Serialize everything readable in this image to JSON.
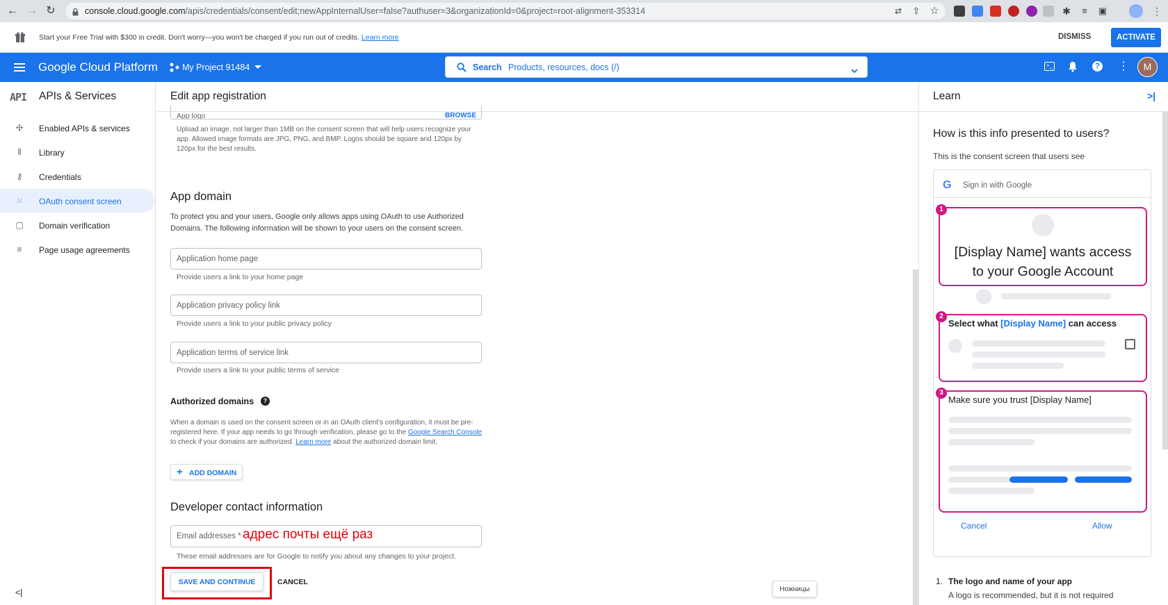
{
  "browser": {
    "url_domain": "console.cloud.google.com",
    "url_path": "/apis/credentials/consent/edit;newAppInternalUser=false?authuser=3&organizationId=0&project=root-alignment-353314"
  },
  "trial_banner": {
    "text": "Start your Free Trial with $300 in credit. Don't worry—you won't be charged if you run out of credits.",
    "learn_more": "Learn more",
    "dismiss": "DISMISS",
    "activate": "ACTIVATE"
  },
  "header": {
    "brand": "Google Cloud Platform",
    "project": "My Project 91484",
    "search_label": "Search",
    "search_placeholder": "Products, resources, docs (/)",
    "avatar_letter": "M"
  },
  "sidebar": {
    "title": "APIs & Services",
    "items": [
      {
        "label": "Enabled APIs & services",
        "icon": "api-diamond-icon"
      },
      {
        "label": "Library",
        "icon": "library-icon"
      },
      {
        "label": "Credentials",
        "icon": "key-icon"
      },
      {
        "label": "OAuth consent screen",
        "icon": "consent-dots-icon"
      },
      {
        "label": "Domain verification",
        "icon": "domain-icon"
      },
      {
        "label": "Page usage agreements",
        "icon": "settings-list-icon"
      }
    ]
  },
  "main": {
    "page_title": "Edit app registration",
    "app_logo": {
      "label": "App logo",
      "browse": "BROWSE",
      "helper": "Upload an image, not larger than 1MB on the consent screen that will help users recognize your app. Allowed image formats are JPG, PNG, and BMP. Logos should be square and 120px by 120px for the best results."
    },
    "app_domain": {
      "heading": "App domain",
      "description": "To protect you and your users, Google only allows apps using OAuth to use Authorized Domains. The following information will be shown to your users on the consent screen.",
      "home_placeholder": "Application home page",
      "home_helper": "Provide users a link to your home page",
      "privacy_placeholder": "Application privacy policy link",
      "privacy_helper": "Provide users a link to your public privacy policy",
      "terms_placeholder": "Application terms of service link",
      "terms_helper": "Provide users a link to your public terms of service"
    },
    "authorized_domains": {
      "heading": "Authorized domains",
      "text_1": "When a domain is used on the consent screen or in an OAuth client's configuration, it must be pre-registered here. If your app needs to go through verification, please go to the",
      "link_1": "Google Search Console",
      "text_2": "to check if your domains are authorized.",
      "link_2": "Learn more",
      "text_3": "about the authorized domain limit.",
      "add_domain": "ADD DOMAIN"
    },
    "developer_contact": {
      "heading": "Developer contact information",
      "email_label": "Email addresses *",
      "annotation": "адрес почты ещё раз",
      "helper": "These email addresses are for Google to notify you about any changes to your project."
    },
    "save_continue": "SAVE AND CONTINUE",
    "cancel": "CANCEL",
    "tooltip": "Ножницы"
  },
  "learn": {
    "title": "Learn",
    "heading": "How is this info presented to users?",
    "subheading": "This is the consent screen that users see",
    "sign_in": "Sign in with Google",
    "box1_num": "1",
    "box1_text_line1": "[Display Name] wants access",
    "box1_text_line2": "to your Google Account",
    "box2_num": "2",
    "box2_pre": "Select what",
    "box2_name": "[Display Name]",
    "box2_post": "can access",
    "box3_num": "3",
    "box3_text": "Make sure you trust [Display Name]",
    "cancel": "Cancel",
    "allow": "Allow",
    "list_num": "1.",
    "list_title": "The logo and name of your app",
    "list_text": "A logo is recommended, but it is not required"
  },
  "colors": {
    "brand_blue": "#1a73e8",
    "highlight_red": "#e0000d",
    "pink": "#d01884"
  }
}
